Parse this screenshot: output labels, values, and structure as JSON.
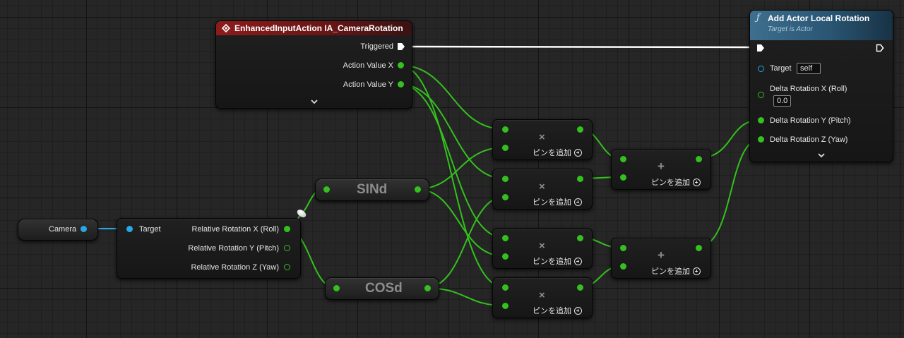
{
  "nodes": {
    "input_action": {
      "title": "EnhancedInputAction IA_CameraRotation",
      "triggered": "Triggered",
      "action_value_x": "Action Value X",
      "action_value_y": "Action Value Y"
    },
    "add_rotation": {
      "title": "Add Actor Local Rotation",
      "subtitle": "Target is Actor",
      "target_label": "Target",
      "target_value": "self",
      "delta_x_label": "Delta Rotation X (Roll)",
      "delta_x_value": "0.0",
      "delta_y_label": "Delta Rotation Y (Pitch)",
      "delta_z_label": "Delta Rotation Z (Yaw)"
    },
    "camera": {
      "label": "Camera"
    },
    "break_rotation": {
      "target_label": "Target",
      "roll_label": "Relative Rotation X (Roll)",
      "pitch_label": "Relative Rotation Y (Pitch)",
      "yaw_label": "Relative Rotation Z (Yaw)"
    },
    "sind": {
      "label": "SINd"
    },
    "cosd": {
      "label": "COSd"
    },
    "multiply": {
      "symbol": "×",
      "add_pin": "ピンを追加"
    },
    "add": {
      "symbol": "+",
      "add_pin": "ピンを追加"
    }
  },
  "colors": {
    "float_pin": "#34c01e",
    "object_pin": "#29a8e8",
    "exec_pin": "#ffffff",
    "event_header": "#8c1c1c",
    "function_header": "#3e6f8e",
    "grid_background": "#262626"
  },
  "icons": {
    "event": "event-diamond-icon",
    "function": "function-f-icon",
    "expand": "chevron-down-icon",
    "add_pin": "plus-circle-icon"
  }
}
